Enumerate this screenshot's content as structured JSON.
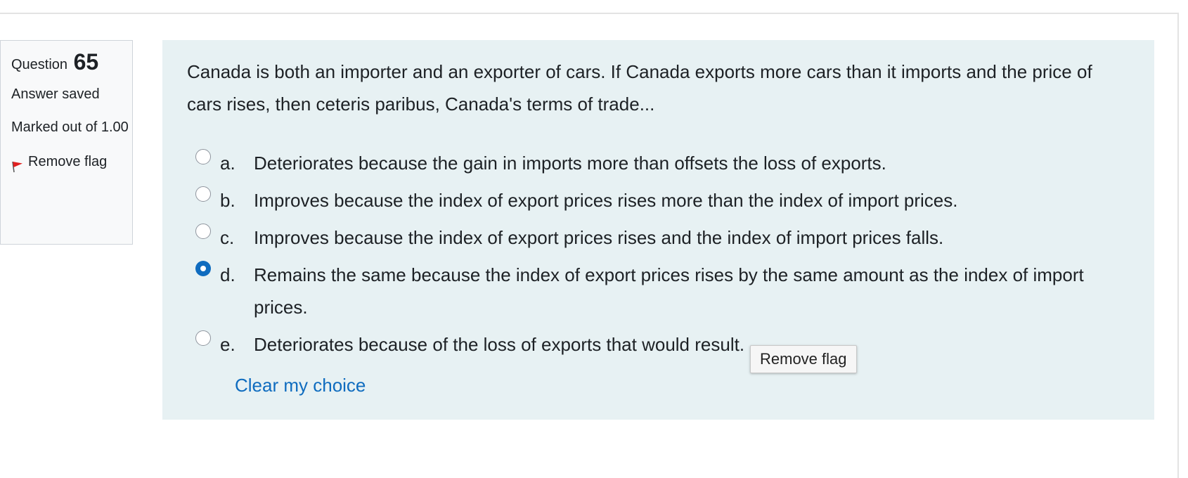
{
  "info": {
    "question_label": "Question",
    "question_number": "65",
    "state": "Answer saved",
    "grade": "Marked out of 1.00",
    "flag_label": "Remove flag",
    "flag_color": "#e02020"
  },
  "question": {
    "text": "Canada is both an importer and an exporter of cars. If Canada exports more cars than it imports and the price of cars rises, then ceteris paribus, Canada's terms of trade..."
  },
  "options": [
    {
      "letter": "a.",
      "text": "Deteriorates because the gain in imports more than offsets the loss of exports.",
      "selected": false
    },
    {
      "letter": "b.",
      "text": "Improves because the index of export prices rises more than the index of import prices.",
      "selected": false
    },
    {
      "letter": "c.",
      "text": "Improves because the index of export prices rises and the index of import prices falls.",
      "selected": false
    },
    {
      "letter": "d.",
      "text": "Remains the same because the index of export prices rises by the same amount as the index of import prices.",
      "selected": true
    },
    {
      "letter": "e.",
      "text": "Deteriorates because of the loss of exports that would result.",
      "selected": false
    }
  ],
  "clear_choice_label": "Clear my choice",
  "tooltip": {
    "text": "Remove flag"
  },
  "colors": {
    "panel_bg": "#e7f1f3",
    "info_bg": "#f8f9fa",
    "link": "#0f6cbf",
    "radio_selected": "#0f6cbf"
  }
}
